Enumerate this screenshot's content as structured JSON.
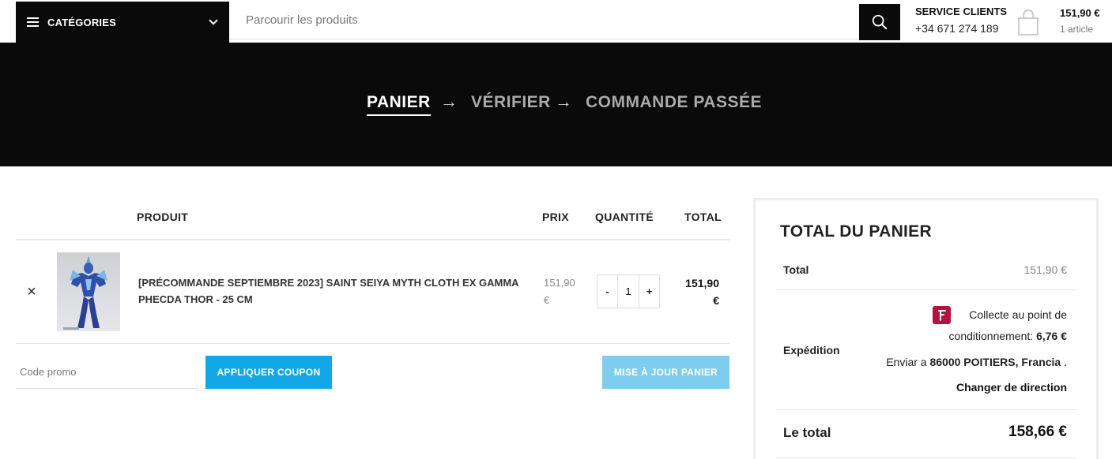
{
  "header": {
    "categories_label": "CATÉGORIES",
    "search_placeholder": "Parcourir les produits",
    "service_title": "SERVICE CLIENTS",
    "service_phone": "+34 671 274 189",
    "cart_price": "151,90 €",
    "cart_count": "1 article"
  },
  "steps": [
    {
      "label": "PANIER",
      "active": true
    },
    {
      "label": "VÉRIFIER",
      "active": false
    },
    {
      "label": "COMMANDE PASSÉE",
      "active": false
    }
  ],
  "step_arrow": "→",
  "table": {
    "headers": {
      "product": "PRODUIT",
      "price": "PRIX",
      "quantity": "QUANTITÉ",
      "total": "TOTAL"
    },
    "rows": [
      {
        "remove": "×",
        "name": "[PRÉCOMMANDE SEPTIEMBRE 2023] SAINT SEIYA MYTH CLOTH EX GAMMA PHECDA THOR - 25 CM",
        "price": "151,90 €",
        "quantity": "1",
        "qty_minus": "-",
        "qty_plus": "+",
        "total": "151,90 €"
      }
    ]
  },
  "coupon": {
    "placeholder": "Code promo",
    "apply_label": "APPLIQUER COUPON",
    "update_label": "MISE À JOUR PANIER"
  },
  "totals": {
    "title": "TOTAL DU PANIER",
    "subtotal_label": "Total",
    "subtotal_value": "151,90 €",
    "shipping_label": "Expédition",
    "shipping_method_a": "Collecte au point de",
    "shipping_method_b": "conditionnement:",
    "shipping_price": "6,76 €",
    "ship_to_prefix": "Enviar a",
    "ship_to_address": "86000 POITIERS, Francia",
    "ship_to_suffix": ".",
    "change_address": "Changer de direction",
    "grand_label": "Le total",
    "grand_value": "158,66 €"
  },
  "colors": {
    "dark": "#0a0a0a",
    "coupon_button": "#12a8e8",
    "update_button": "#7fcdee",
    "shipping_brand": "#b3133f"
  },
  "icons": {
    "menu": "hamburger-icon",
    "categories_toggle": "chevron-down-icon",
    "search": "search-icon",
    "cart": "shopping-bag-icon",
    "remove": "close-icon",
    "shipping": "pickup-point-icon"
  }
}
